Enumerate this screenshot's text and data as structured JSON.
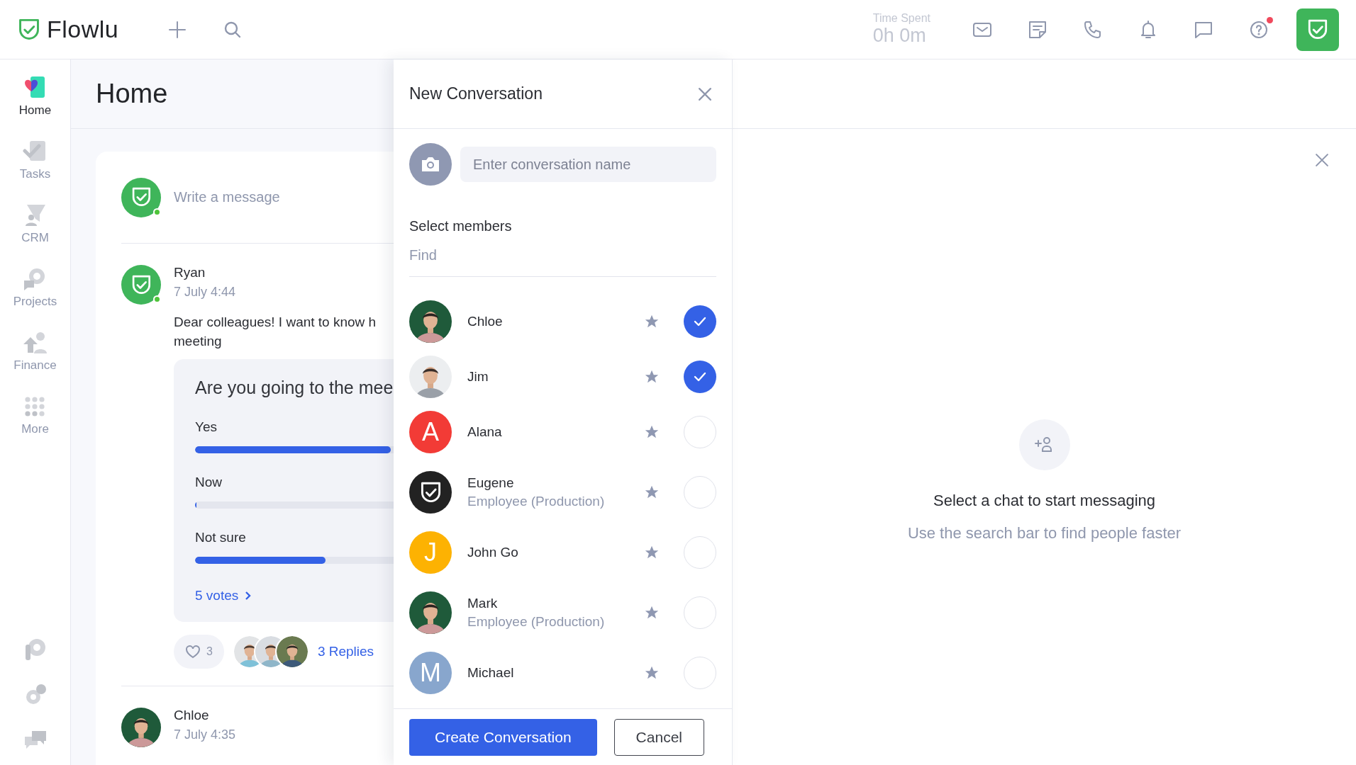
{
  "top_bar": {
    "logo": "Flowlu",
    "time_spent": {
      "label": "Time Spent",
      "value": "0h 0m"
    },
    "help_unread": true
  },
  "sidebar": {
    "items": [
      {
        "label": "Home",
        "selected": true
      },
      {
        "label": "Tasks",
        "selected": false
      },
      {
        "label": "CRM",
        "selected": false
      },
      {
        "label": "Projects",
        "selected": false
      },
      {
        "label": "Finance",
        "selected": false
      },
      {
        "label": "More",
        "selected": false
      }
    ]
  },
  "home": {
    "title": "Home",
    "composer": {
      "placeholder": "Write a message",
      "online": true
    },
    "posts": [
      {
        "author": "Ryan",
        "avatar": {
          "kind": "logo",
          "color": "#3fb55a"
        },
        "online": true,
        "time": "7 July 4:44",
        "text": "Dear colleagues! I want to know h\nmeeting",
        "poll": {
          "question": "Are you going to the mee",
          "options": [
            {
              "label": "Yes",
              "level": 0.6
            },
            {
              "label": "Now",
              "level": 0
            },
            {
              "label": "Not sure",
              "level": 0.4
            }
          ],
          "votes": "5 votes"
        },
        "likes": "3",
        "replies": "3 Replies"
      },
      {
        "author": "Chloe",
        "time": "7 July 4:35"
      }
    ]
  },
  "new_conversation": {
    "title": "New Conversation",
    "name_field": {
      "placeholder": "Enter conversation name"
    },
    "members_label": "Select members",
    "find": {
      "placeholder": "Find"
    },
    "members": [
      {
        "name": "Chloe",
        "selected": true
      },
      {
        "name": "Jim",
        "selected": true
      },
      {
        "name": "Alana",
        "avatar": {
          "kind": "letter",
          "letter": "A",
          "color": "#f23b36"
        },
        "selected": false
      },
      {
        "name": "Eugene",
        "role": "Employee (Production)",
        "avatar": {
          "kind": "logo",
          "color": "#222222"
        },
        "selected": false
      },
      {
        "name": "John Go",
        "avatar": {
          "kind": "letter",
          "letter": "J",
          "color": "#fdb202"
        },
        "selected": false
      },
      {
        "name": "Mark",
        "role": "Employee (Production)",
        "selected": false
      },
      {
        "name": "Michael",
        "avatar": {
          "kind": "letter",
          "letter": "M",
          "color": "#88a6cd"
        },
        "selected": false
      }
    ],
    "buttons": [
      {
        "label": "Create Conversation",
        "kind": "primary"
      },
      {
        "label": "Cancel",
        "kind": "secondary"
      }
    ]
  },
  "chat_pane": {
    "empty_title": "Select a chat to start messaging",
    "empty_hint": "Use the search bar to find people faster"
  }
}
